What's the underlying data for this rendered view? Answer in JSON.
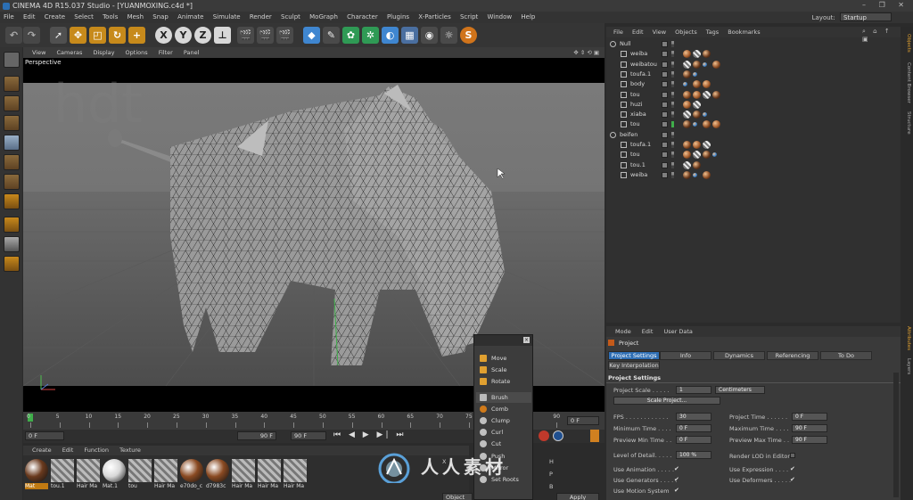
{
  "window": {
    "title": "CINEMA 4D R15.037 Studio - [YUANMOXING.c4d *]",
    "controls": "– ❐ ✕"
  },
  "menu": [
    "File",
    "Edit",
    "Create",
    "Select",
    "Tools",
    "Mesh",
    "Snap",
    "Animate",
    "Simulate",
    "Render",
    "Sculpt",
    "MoGraph",
    "Character",
    "Plugins",
    "X-Particles",
    "Script",
    "Window",
    "Help"
  ],
  "layout": {
    "label": "Layout:",
    "value": "Startup"
  },
  "viewport": {
    "menu": [
      "View",
      "Cameras",
      "Display",
      "Options",
      "Filter",
      "Panel"
    ],
    "label": "Perspective"
  },
  "timeline": {
    "ticks": [
      "0",
      "5",
      "10",
      "15",
      "20",
      "25",
      "30",
      "35",
      "40",
      "45",
      "50",
      "55",
      "60",
      "65",
      "70",
      "75",
      "80",
      "85",
      "90"
    ],
    "current_frame": "0 F",
    "end_frame": "0 F"
  },
  "playbar": {
    "start": "0 F",
    "preview_end": "90 F",
    "end": "90 F"
  },
  "materials": {
    "menu": [
      "Create",
      "Edit",
      "Function",
      "Texture"
    ],
    "items": [
      {
        "label": "Mat",
        "ball": "#6a3a1e"
      },
      {
        "label": "tou.1",
        "ball": "#9a9a9a"
      },
      {
        "label": "Hair Ma",
        "ball": "#9a9a9a"
      },
      {
        "label": "Mat.1",
        "ball": "#d8d8d8"
      },
      {
        "label": "tou",
        "ball": "#9a9a9a"
      },
      {
        "label": "Hair Ma",
        "ball": "#9a9a9a"
      },
      {
        "label": "e70do_c",
        "ball": "#8a4a22"
      },
      {
        "label": "d7983c",
        "ball": "#8a4a22"
      },
      {
        "label": "Hair Ma",
        "ball": "#9a9a9a"
      },
      {
        "label": "Hair Ma",
        "ball": "#9a9a9a"
      },
      {
        "label": "Hair Ma",
        "ball": "#9a9a9a"
      }
    ]
  },
  "objects": {
    "menu": [
      "File",
      "Edit",
      "View",
      "Objects",
      "Tags",
      "Bookmarks"
    ],
    "rows": [
      {
        "name": "Null",
        "indent": 0
      },
      {
        "name": "weiba",
        "indent": 1
      },
      {
        "name": "weibatou",
        "indent": 1
      },
      {
        "name": "toufa.1",
        "indent": 1
      },
      {
        "name": "body",
        "indent": 1
      },
      {
        "name": "tou",
        "indent": 1
      },
      {
        "name": "huzi",
        "indent": 1
      },
      {
        "name": "xiaba",
        "indent": 1
      },
      {
        "name": "tou",
        "indent": 1
      },
      {
        "name": "beifen",
        "indent": 0
      },
      {
        "name": "toufa.1",
        "indent": 1
      },
      {
        "name": "tou",
        "indent": 1
      },
      {
        "name": "tou.1",
        "indent": 1
      },
      {
        "name": "weiba",
        "indent": 1
      }
    ]
  },
  "sidetabs": [
    "Objects",
    "Content Browser",
    "Structure",
    "Attributes",
    "Layers"
  ],
  "attributes": {
    "menu": [
      "Mode",
      "Edit",
      "User Data"
    ],
    "header": "Project",
    "tabs": [
      "Project Settings",
      "Info",
      "Dynamics",
      "Referencing",
      "To Do",
      "Key Interpolation"
    ],
    "section": "Project Settings",
    "project_scale_label": "Project Scale . . . . .",
    "project_scale_value": "1",
    "project_scale_unit": "Centimeters",
    "scale_button": "Scale Project...",
    "fields": [
      {
        "label": "FPS . . . . . . . . . . . .",
        "value": "30"
      },
      {
        "label": "Minimum Time . . . .",
        "value": "0 F"
      },
      {
        "label": "Preview Min Time . .",
        "value": "0 F"
      },
      {
        "label": "Level of Detail. . . . .",
        "value": "100 %"
      }
    ],
    "fields_right": [
      {
        "label": "Project Time . . . . . .",
        "value": "0 F"
      },
      {
        "label": "Maximum Time . . . .",
        "value": "90 F"
      },
      {
        "label": "Preview Max Time . .",
        "value": "90 F"
      }
    ],
    "render_lod": "Render LOD in Editor",
    "checks_left": [
      "Use Animation . . . . .",
      "Use Generators . . . . .",
      "Use Motion System"
    ],
    "checks_right": [
      "Use Expression . . . .",
      "Use Deformers . . . . ."
    ],
    "apply": "Apply"
  },
  "popup": {
    "items": [
      "Move",
      "Scale",
      "Rotate",
      "Brush",
      "Comb",
      "Clump",
      "Curl",
      "Cut",
      "Push",
      "Mirror",
      "Set Roots"
    ]
  },
  "watermark": {
    "text": "人人素材"
  },
  "coords": {
    "x_label": "X",
    "y_label": "Y",
    "z_label": "Z",
    "h_label": "H",
    "p_label": "P",
    "b_label": "B",
    "object_label": "Object"
  }
}
